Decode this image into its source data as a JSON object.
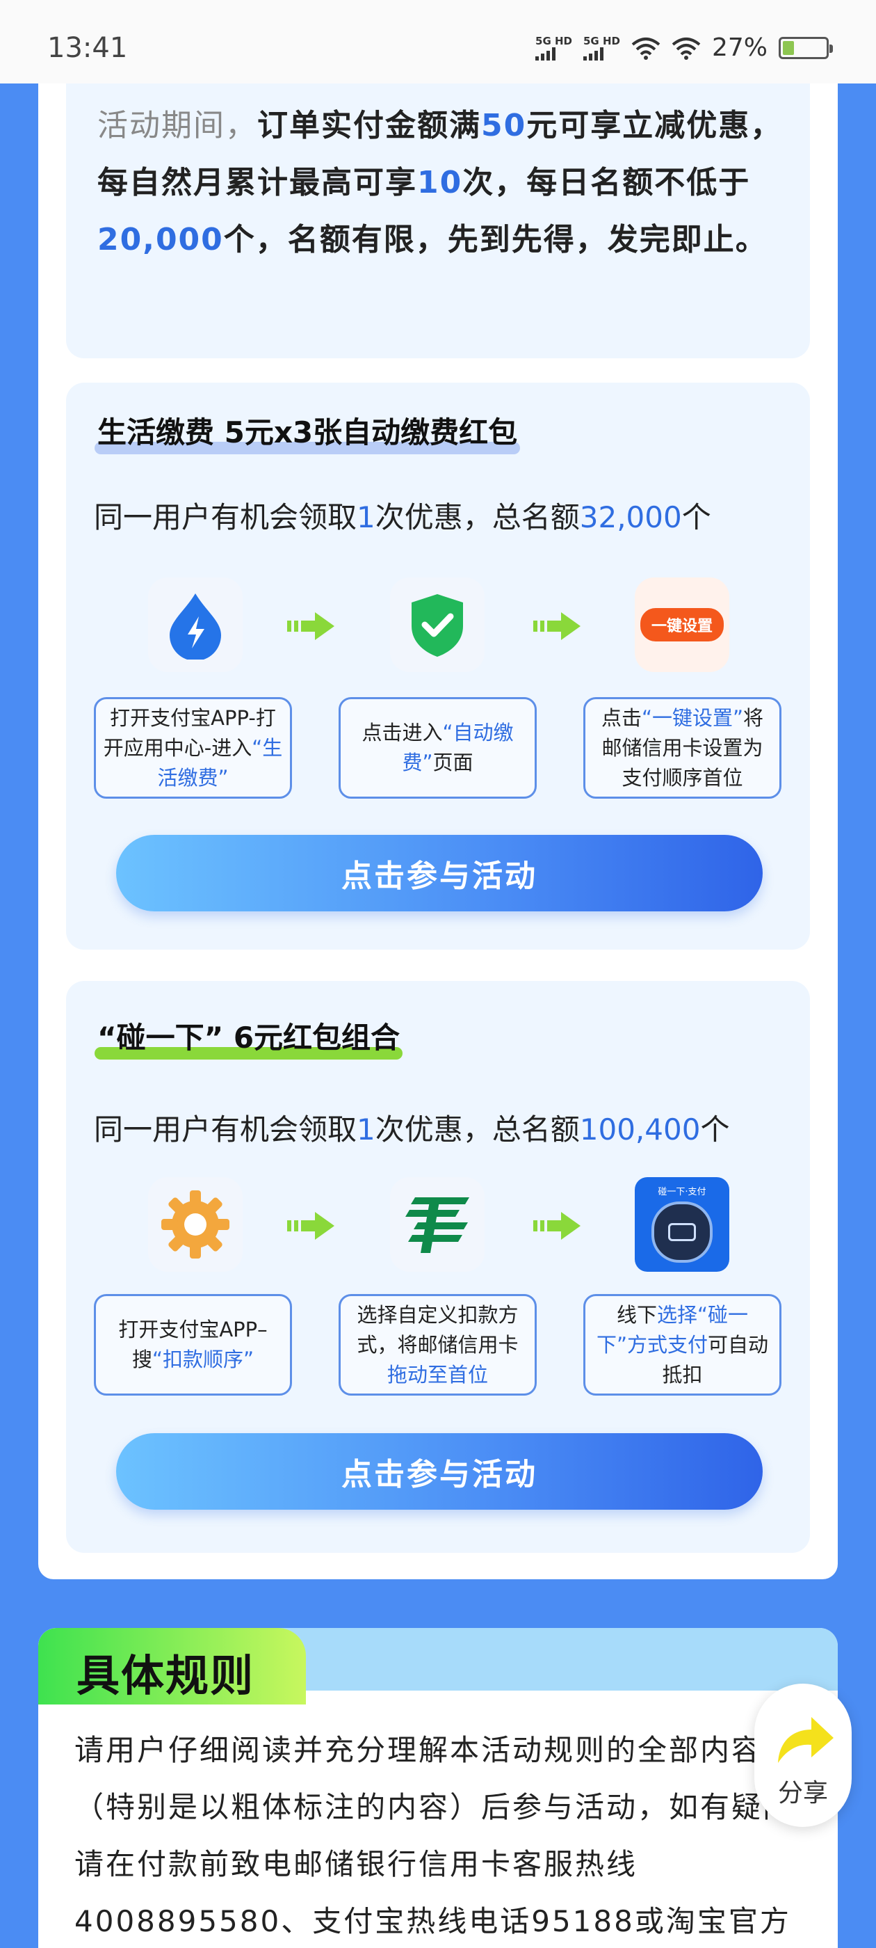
{
  "status_bar": {
    "time": "13:41",
    "signal1_label": "5G HD",
    "signal2_label": "5G HD",
    "battery_text": "27%",
    "battery_level": 0.27
  },
  "intro": {
    "lead": "活动期间，",
    "p1": "订单实付金额满",
    "v1": "50",
    "p2": "元可享立减优惠，每自然月累计最高可享",
    "v2": "10",
    "p3": "次，每日名额不低于",
    "v3": "20,000",
    "p4": "个，名额有限，先到先得，发完即止。"
  },
  "section1": {
    "title": "生活缴费 5元x3张自动缴费红包",
    "sub_pre": "同一用户有机会领取",
    "sub_v1": "1",
    "sub_mid": "次优惠，总名额",
    "sub_v2": "32,000",
    "sub_post": "个",
    "step3_badge": "一键设置",
    "steps": [
      {
        "a": "打开支付宝APP-打开应用中心-进入",
        "b": "“生活缴费”",
        "c": ""
      },
      {
        "a": "点击进入",
        "b": "“自动缴费”",
        "c": "页面"
      },
      {
        "a": "点击",
        "b": "“一键设置”",
        "c": "将邮储信用卡设置为支付顺序首位"
      }
    ],
    "cta": "点击参与活动"
  },
  "section2": {
    "title": "“碰一下” 6元红包组合",
    "sub_pre": "同一用户有机会领取",
    "sub_v1": "1",
    "sub_mid": "次优惠，总名额",
    "sub_v2": "100,400",
    "sub_post": "个",
    "tile_top": "碰一下·支付",
    "steps": [
      {
        "a": "打开支付宝APP–搜",
        "b": "“扣款顺序”",
        "c": ""
      },
      {
        "a": "选择自定义扣款方式，将邮储信用卡",
        "b": "拖动至首位",
        "c": ""
      },
      {
        "a": "线下",
        "b": "选择“碰一下”方式支付",
        "c": "可自动抵扣"
      }
    ],
    "cta": "点击参与活动"
  },
  "rules": {
    "title": "具体规则",
    "text": "请用户仔细阅读并充分理解本活动规则的全部内容（特别是以粗体标注的内容）后参与活动，如有疑问请在付款前致电邮储银行信用卡客服热线4008895580、支付宝热线电话95188或淘宝官方"
  },
  "share": {
    "label": "分享"
  },
  "colors": {
    "accent": "#2f6de1",
    "page_bg": "#4b8cf3",
    "green": "#8ad83a"
  }
}
